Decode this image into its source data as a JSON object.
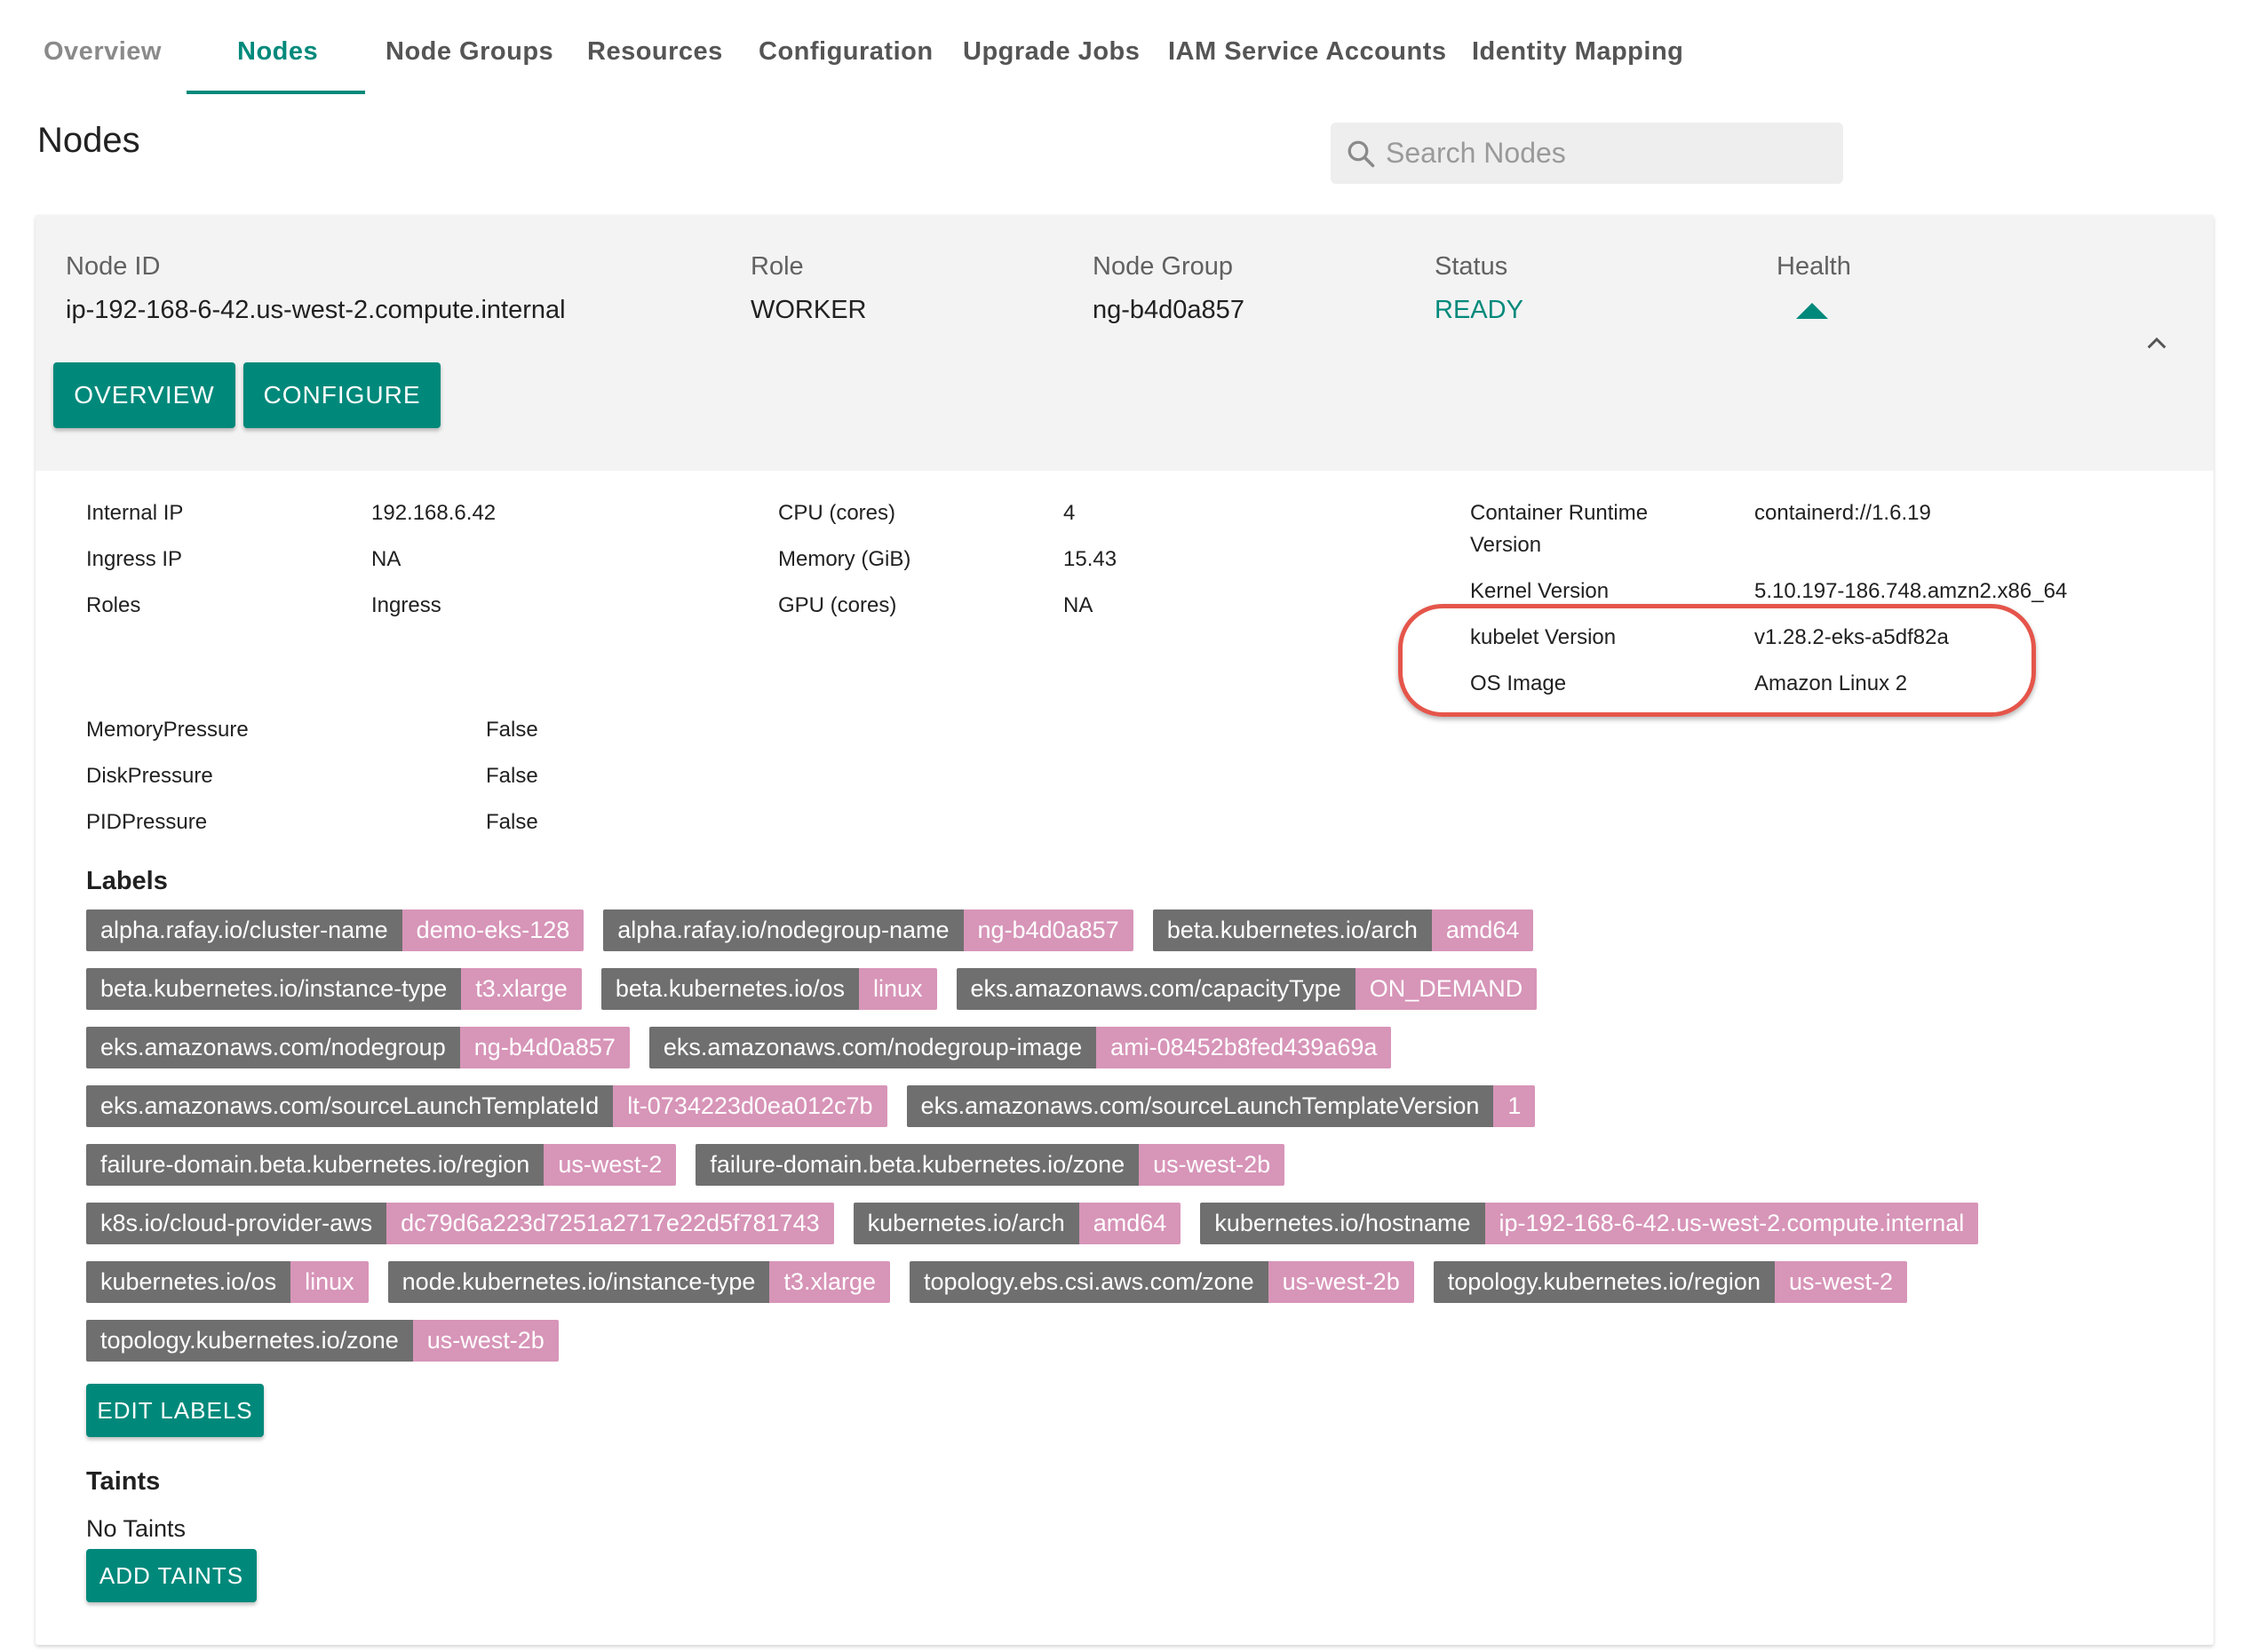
{
  "tabs": [
    {
      "label": "Overview"
    },
    {
      "label": "Nodes"
    },
    {
      "label": "Node Groups"
    },
    {
      "label": "Resources"
    },
    {
      "label": "Configuration"
    },
    {
      "label": "Upgrade Jobs"
    },
    {
      "label": "IAM Service Accounts"
    },
    {
      "label": "Identity Mapping"
    }
  ],
  "active_tab": "Nodes",
  "page_title": "Nodes",
  "search": {
    "placeholder": "Search Nodes",
    "value": ""
  },
  "node": {
    "id_label": "Node ID",
    "id": "ip-192-168-6-42.us-west-2.compute.internal",
    "role_label": "Role",
    "role": "WORKER",
    "group_label": "Node Group",
    "group": "ng-b4d0a857",
    "status_label": "Status",
    "status": "READY",
    "health_label": "Health"
  },
  "buttons": {
    "overview": "OVERVIEW",
    "configure": "CONFIGURE",
    "edit_labels": "EDIT LABELS",
    "add_taints": "ADD TAINTS"
  },
  "details": {
    "internal_ip_label": "Internal IP",
    "internal_ip": "192.168.6.42",
    "ingress_ip_label": "Ingress IP",
    "ingress_ip": "NA",
    "roles_label": "Roles",
    "roles": "Ingress",
    "cpu_label": "CPU (cores)",
    "cpu": "4",
    "memory_label": "Memory (GiB)",
    "memory": "15.43",
    "gpu_label": "GPU (cores)",
    "gpu": "NA",
    "runtime_label_1": "Container Runtime",
    "runtime_label_2": "Version",
    "runtime": "containerd://1.6.19",
    "kernel_label": "Kernel Version",
    "kernel": "5.10.197-186.748.amzn2.x86_64",
    "kubelet_label": "kubelet Version",
    "kubelet": "v1.28.2-eks-a5df82a",
    "os_label": "OS Image",
    "os": "Amazon Linux 2"
  },
  "conditions": [
    {
      "name": "MemoryPressure",
      "value": "False"
    },
    {
      "name": "DiskPressure",
      "value": "False"
    },
    {
      "name": "PIDPressure",
      "value": "False"
    }
  ],
  "labels_title": "Labels",
  "label_rows": [
    [
      {
        "k": "alpha.rafay.io/cluster-name",
        "v": "demo-eks-128"
      },
      {
        "k": "alpha.rafay.io/nodegroup-name",
        "v": "ng-b4d0a857"
      },
      {
        "k": "beta.kubernetes.io/arch",
        "v": "amd64"
      }
    ],
    [
      {
        "k": "beta.kubernetes.io/instance-type",
        "v": "t3.xlarge"
      },
      {
        "k": "beta.kubernetes.io/os",
        "v": "linux"
      },
      {
        "k": "eks.amazonaws.com/capacityType",
        "v": "ON_DEMAND"
      }
    ],
    [
      {
        "k": "eks.amazonaws.com/nodegroup",
        "v": "ng-b4d0a857"
      },
      {
        "k": "eks.amazonaws.com/nodegroup-image",
        "v": "ami-08452b8fed439a69a"
      }
    ],
    [
      {
        "k": "eks.amazonaws.com/sourceLaunchTemplateId",
        "v": "lt-0734223d0ea012c7b"
      },
      {
        "k": "eks.amazonaws.com/sourceLaunchTemplateVersion",
        "v": "1"
      }
    ],
    [
      {
        "k": "failure-domain.beta.kubernetes.io/region",
        "v": "us-west-2"
      },
      {
        "k": "failure-domain.beta.kubernetes.io/zone",
        "v": "us-west-2b"
      }
    ],
    [
      {
        "k": "k8s.io/cloud-provider-aws",
        "v": "dc79d6a223d7251a2717e22d5f781743"
      },
      {
        "k": "kubernetes.io/arch",
        "v": "amd64"
      },
      {
        "k": "kubernetes.io/hostname",
        "v": "ip-192-168-6-42.us-west-2.compute.internal"
      }
    ],
    [
      {
        "k": "kubernetes.io/os",
        "v": "linux"
      },
      {
        "k": "node.kubernetes.io/instance-type",
        "v": "t3.xlarge"
      },
      {
        "k": "topology.ebs.csi.aws.com/zone",
        "v": "us-west-2b"
      },
      {
        "k": "topology.kubernetes.io/region",
        "v": "us-west-2"
      }
    ],
    [
      {
        "k": "topology.kubernetes.io/zone",
        "v": "us-west-2b"
      }
    ]
  ],
  "taints_title": "Taints",
  "taints_empty": "No Taints",
  "colors": {
    "accent": "#00897b",
    "chip_key": "#6f6f6f",
    "chip_value": "#d795b8",
    "highlight": "#e5554a"
  }
}
